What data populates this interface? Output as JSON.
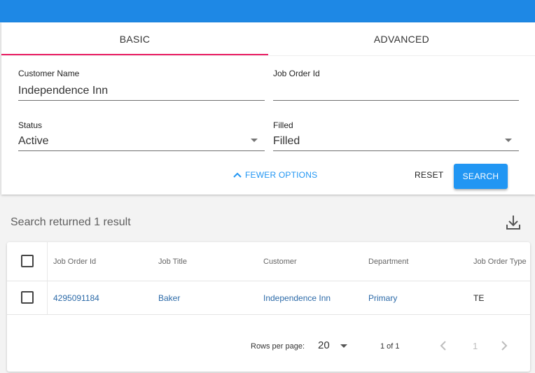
{
  "tabs": {
    "basic": "BASIC",
    "advanced": "ADVANCED"
  },
  "form": {
    "customer_name": {
      "label": "Customer Name",
      "value": "Independence Inn"
    },
    "job_order_id": {
      "label": "Job Order Id",
      "value": ""
    },
    "status": {
      "label": "Status",
      "value": "Active"
    },
    "filled": {
      "label": "Filled",
      "value": "Filled"
    }
  },
  "actions": {
    "fewer_options": "FEWER OPTIONS",
    "reset": "RESET",
    "search": "SEARCH"
  },
  "results": {
    "title": "Search returned 1 result"
  },
  "table": {
    "headers": [
      "Job Order Id",
      "Job Title",
      "Customer",
      "Department",
      "Job Order Type"
    ],
    "rows": [
      [
        "4295091184",
        "Baker",
        "Independence Inn",
        "Primary",
        "TE"
      ]
    ]
  },
  "pagination": {
    "rows_per_page_label": "Rows per page:",
    "rows_per_page": "20",
    "range": "1 of 1",
    "page": "1"
  },
  "colors": {
    "primary": "#2196f3",
    "topbar": "#1e88e5",
    "tab_indicator": "#e91e63",
    "link": "#2c6aa8"
  },
  "icons": {
    "collapse": "chevron-up-icon",
    "download": "download-icon",
    "prev": "chevron-left-icon",
    "next": "chevron-right-icon"
  }
}
